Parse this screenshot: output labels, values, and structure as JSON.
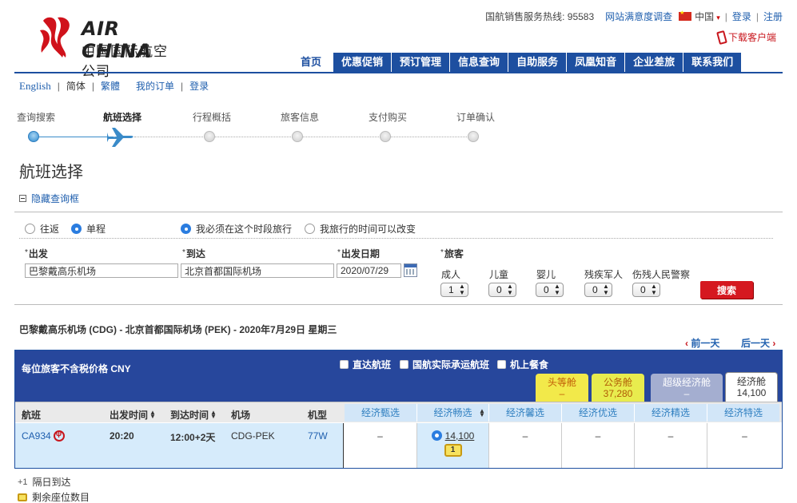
{
  "brand": {
    "name_en": "AIR CHINA",
    "name_cn": "中国国际航空公司"
  },
  "topbar": {
    "hotline": "国航销售服务热线: 95583",
    "survey": "网站满意度调查",
    "country": "中国",
    "login": "登录",
    "register": "注册",
    "download": "下载客户端"
  },
  "mainnav": [
    "首页",
    "优惠促销",
    "预订管理",
    "信息查询",
    "自助服务",
    "凤凰知音",
    "企业差旅",
    "联系我们"
  ],
  "subnav": {
    "english": "English",
    "simplified": "简体",
    "traditional": "繁體",
    "my_orders": "我的订单",
    "login": "登录"
  },
  "steps": [
    "查询搜索",
    "航班选择",
    "行程概括",
    "旅客信息",
    "支付购买",
    "订单确认"
  ],
  "page_title": "航班选择",
  "hide_search": "隐藏查询框",
  "search": {
    "trip_options": [
      "往返",
      "单程"
    ],
    "time_options": [
      "我必须在这个时段旅行",
      "我旅行的时间可以改变"
    ],
    "from_label": "出发",
    "to_label": "到达",
    "date_label": "出发日期",
    "pax_label": "旅客",
    "from_value": "巴黎戴高乐机场",
    "to_value": "北京首都国际机场",
    "date_value": "2020/07/29",
    "pax": [
      {
        "label": "成人",
        "value": "1"
      },
      {
        "label": "儿童",
        "value": "0"
      },
      {
        "label": "婴儿",
        "value": "0"
      },
      {
        "label": "残疾军人",
        "value": "0"
      },
      {
        "label": "伤残人民警察",
        "value": "0"
      }
    ],
    "button": "搜索"
  },
  "route": "巴黎戴高乐机场 (CDG) - 北京首都国际机场 (PEK) - 2020年7月29日 星期三",
  "day_nav": {
    "prev": "前一天",
    "next": "后一天"
  },
  "results": {
    "price_note": "每位旅客不含税价格 CNY",
    "filters": [
      "直达航班",
      "国航实际承运航班",
      "机上餐食"
    ],
    "cabins": [
      {
        "name": "头等舱",
        "price": "–"
      },
      {
        "name": "公务舱",
        "price": "37,280"
      },
      {
        "name": "超级经济舱",
        "price": "–"
      },
      {
        "name": "经济舱",
        "price": "14,100"
      }
    ],
    "columns": [
      "航班",
      "出发时间",
      "到达时间",
      "机场",
      "机型"
    ],
    "fare_columns": [
      "经济甄选",
      "经济畅选",
      "经济馨选",
      "经济优选",
      "经济精选",
      "经济特选"
    ],
    "flight": {
      "number": "CA934",
      "depart": "20:20",
      "arrive": "12:00+2天",
      "airports": "CDG-PEK",
      "aircraft": "77W",
      "fares": [
        "–",
        "14,100",
        "–",
        "–",
        "–",
        "–"
      ],
      "seats_left": "1"
    }
  },
  "legend": {
    "next_day_mark": "+1",
    "next_day": "隔日到达",
    "seats": "剩余座位数目"
  }
}
